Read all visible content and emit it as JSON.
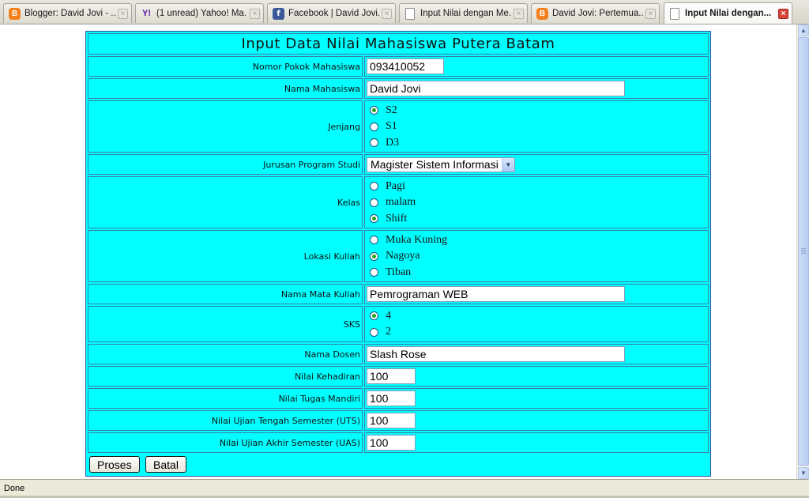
{
  "tabs": [
    {
      "title": "Blogger: David Jovi - ...",
      "icon": "blogger-icon",
      "active": false
    },
    {
      "title": "(1 unread) Yahoo! Ma...",
      "icon": "yahoo-icon",
      "active": false
    },
    {
      "title": "Facebook | David Jovi...",
      "icon": "facebook-icon",
      "active": false
    },
    {
      "title": "Input Nilai dengan Me...",
      "icon": "page-icon",
      "active": false
    },
    {
      "title": "David Jovi: Pertemua...",
      "icon": "blogger-icon",
      "active": false
    },
    {
      "title": "Input Nilai dengan...",
      "icon": "page-icon",
      "active": true
    }
  ],
  "form": {
    "title": "Input Data Nilai Mahasiswa Putera Batam",
    "nim": {
      "label": "Nomor Pokok Mahasiswa",
      "value": "093410052"
    },
    "nama": {
      "label": "Nama Mahasiswa",
      "value": "David Jovi"
    },
    "jenjang": {
      "label": "Jenjang",
      "options": [
        "S2",
        "S1",
        "D3"
      ],
      "selected": "S2"
    },
    "jurusan": {
      "label": "Jurusan Program Studi",
      "value": "Magister Sistem Informasi"
    },
    "kelas": {
      "label": "Kelas",
      "options": [
        "Pagi",
        "malam",
        "Shift"
      ],
      "selected": "Shift"
    },
    "lokasi": {
      "label": "Lokasi Kuliah",
      "options": [
        "Muka Kuning",
        "Nagoya",
        "Tiban"
      ],
      "selected": "Nagoya"
    },
    "matakuliah": {
      "label": "Nama Mata Kuliah",
      "value": "Pemrograman WEB"
    },
    "sks": {
      "label": "SKS",
      "options": [
        "4",
        "2"
      ],
      "selected": "4"
    },
    "dosen": {
      "label": "Nama Dosen",
      "value": "Slash Rose"
    },
    "kehadiran": {
      "label": "Nilai Kehadiran",
      "value": "100"
    },
    "tugas": {
      "label": "Nilai Tugas Mandiri",
      "value": "100"
    },
    "uts": {
      "label": "Nilai Ujian Tengah Semester (UTS)",
      "value": "100"
    },
    "uas": {
      "label": "Nilai Ujian Akhir Semester (UAS)",
      "value": "100"
    },
    "buttons": {
      "proses": "Proses",
      "batal": "Batal"
    }
  },
  "status": {
    "text": "Done"
  },
  "colors": {
    "form_background": "#00ffff",
    "cell_border": "#3a7fa8"
  }
}
